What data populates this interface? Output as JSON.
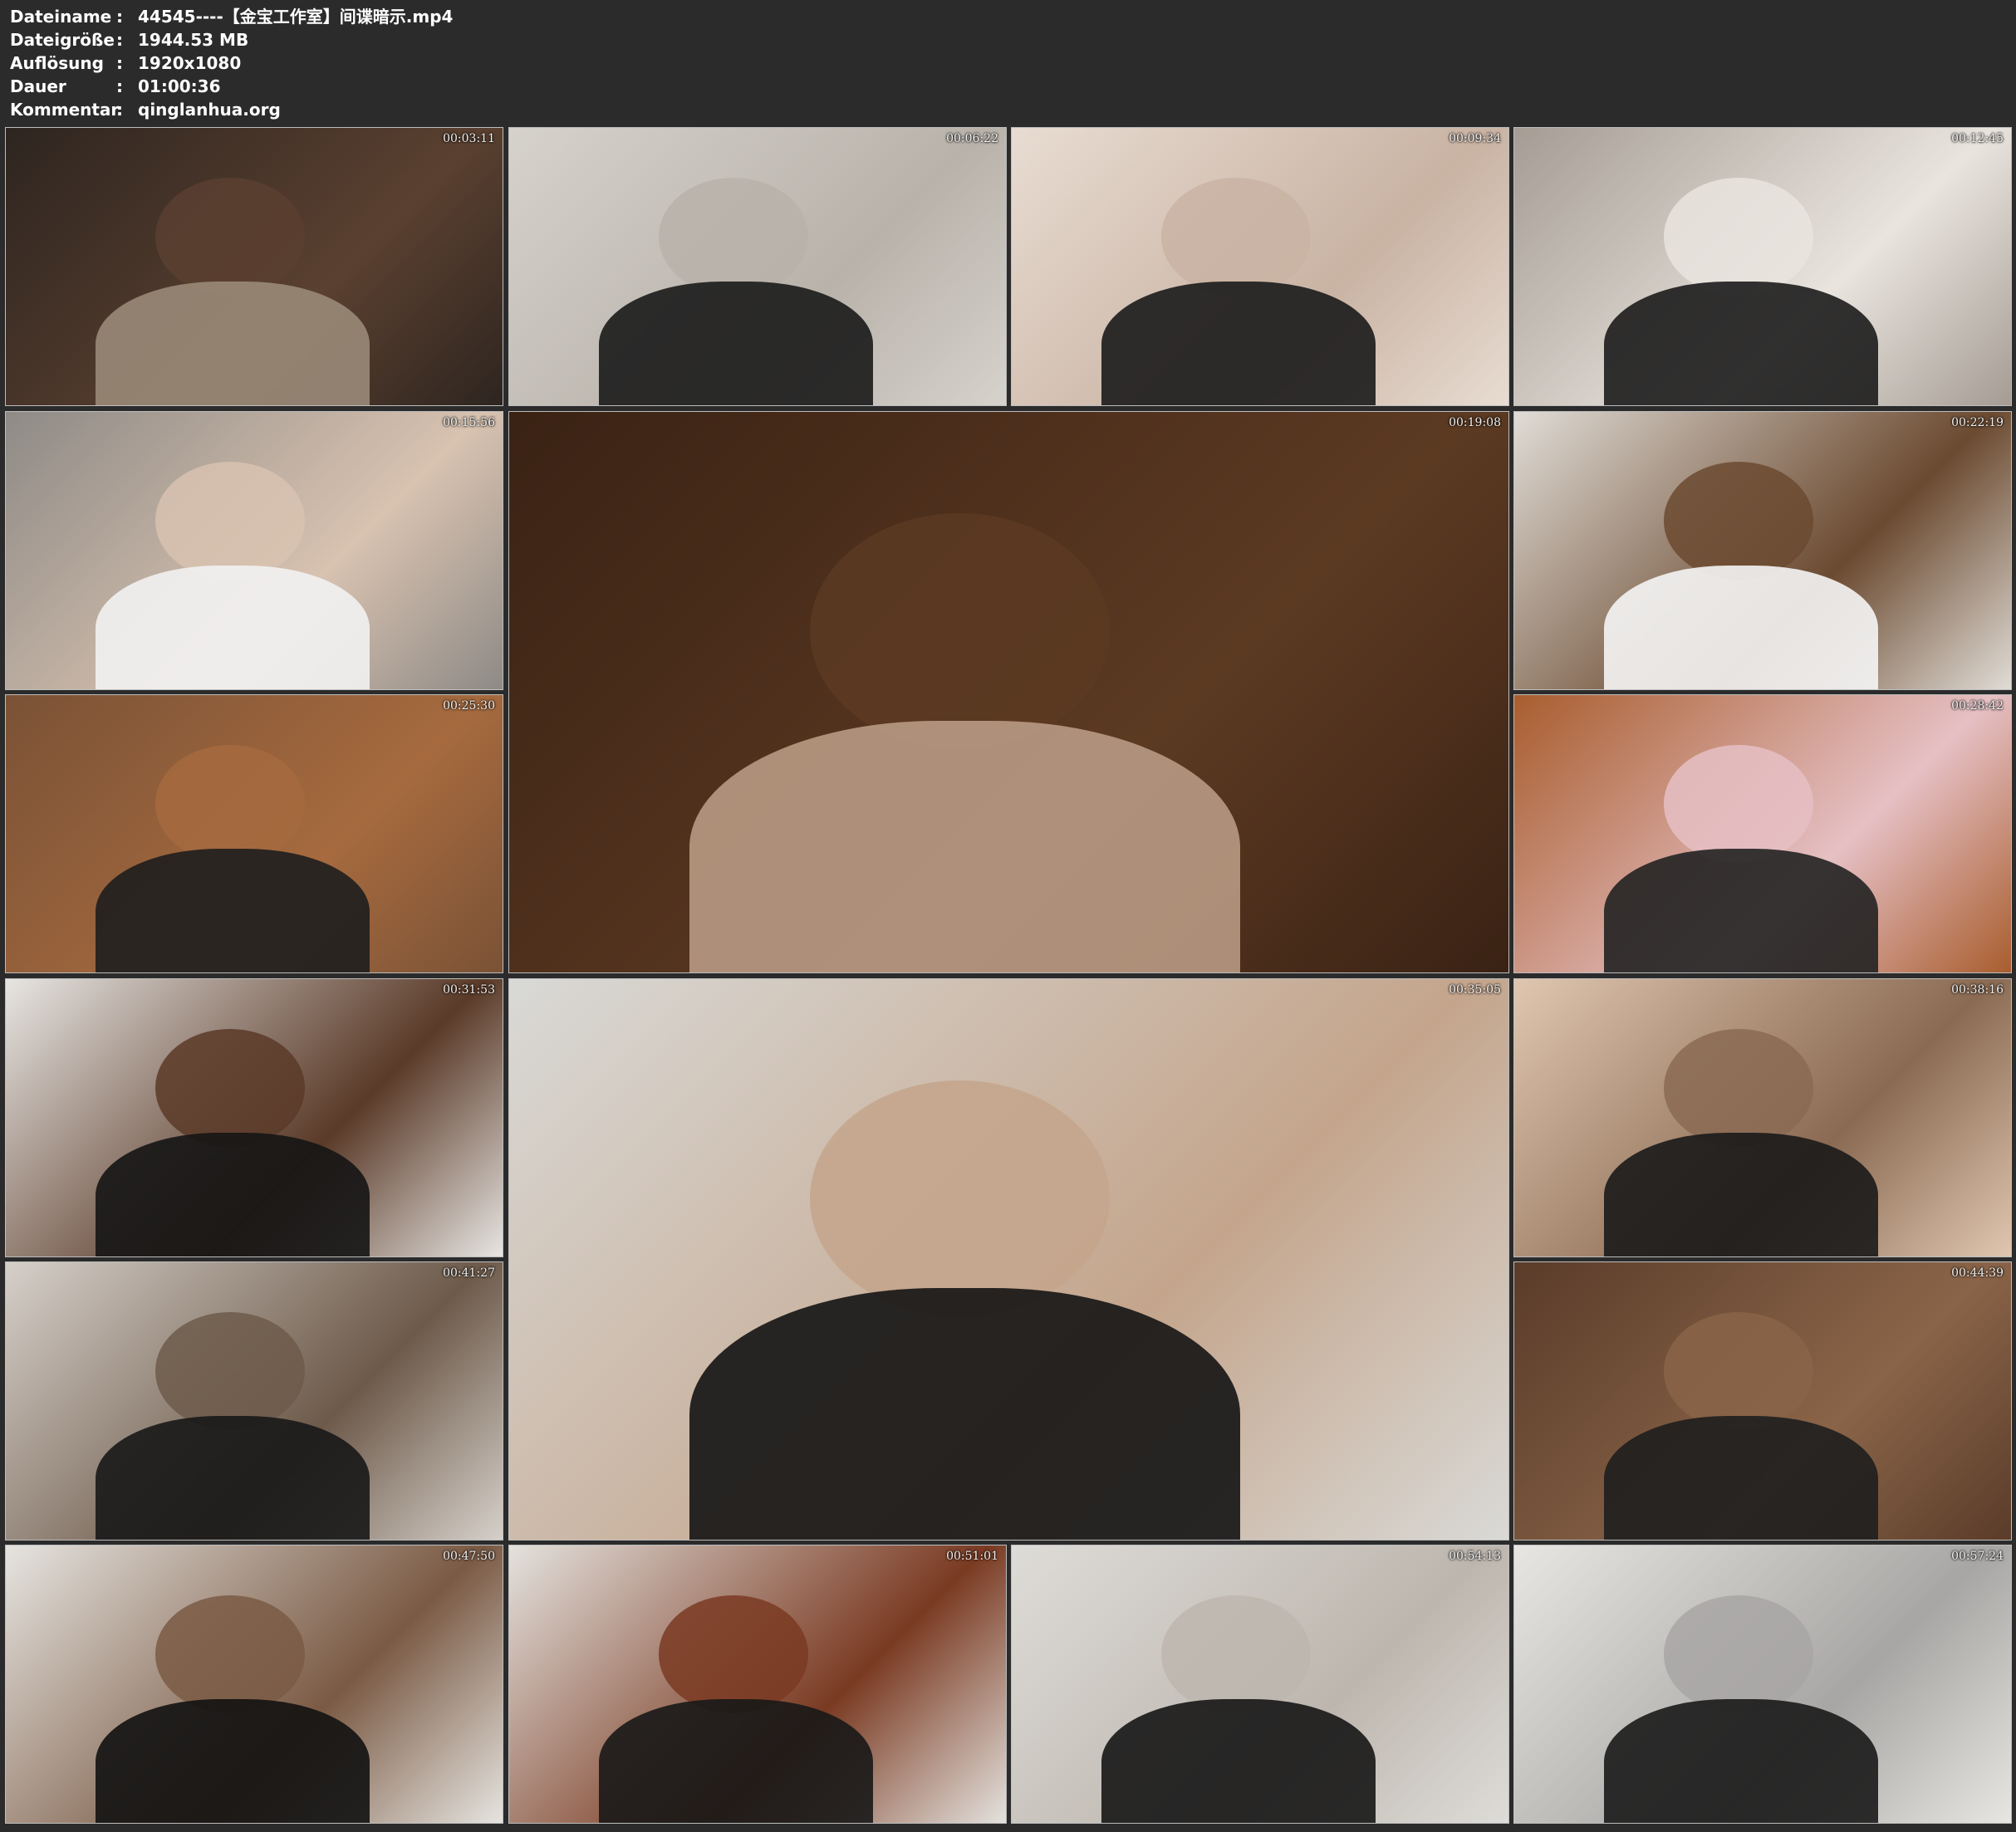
{
  "header": {
    "rows": [
      {
        "label": "Dateiname",
        "sep": ":",
        "value": "44545----【金宝工作室】间谍暗示.mp4"
      },
      {
        "label": "Dateigröße",
        "sep": ":",
        "value": "1944.53 MB"
      },
      {
        "label": "Auflösung",
        "sep": ":",
        "value": "1920x1080"
      },
      {
        "label": "Dauer",
        "sep": ":",
        "value": "01:00:36"
      },
      {
        "label": "Kommentar",
        "sep": ":",
        "value": "qinglanhua.org"
      }
    ]
  },
  "thumbnails": [
    {
      "time": "00:03:11",
      "colors": [
        "#2e2520",
        "#5a4030",
        "#9a8a78"
      ]
    },
    {
      "time": "00:06:22",
      "colors": [
        "#d6d2cc",
        "#b8b2aa",
        "#1a1a1a"
      ]
    },
    {
      "time": "00:09:34",
      "colors": [
        "#e8dcd2",
        "#c9b3a3",
        "#1b1b1b"
      ]
    },
    {
      "time": "00:12:45",
      "colors": [
        "#a59c94",
        "#e9e4de",
        "#1c1c1c"
      ]
    },
    {
      "time": "00:15:56",
      "colors": [
        "#8e8a86",
        "#d8c2b0",
        "#f2f2f2"
      ]
    },
    {
      "time": "00:19:08",
      "colors": [
        "#3a2214",
        "#5c3a22",
        "#b89a84"
      ]
    },
    {
      "time": "00:22:19",
      "colors": [
        "#e0dcd6",
        "#6b4a30",
        "#f5f5f5"
      ]
    },
    {
      "time": "00:25:30",
      "colors": [
        "#7a5236",
        "#a66a3e",
        "#1e1e1e"
      ]
    },
    {
      "time": "00:28:42",
      "colors": [
        "#a85d2e",
        "#e6c0c4",
        "#222222"
      ]
    },
    {
      "time": "00:31:53",
      "colors": [
        "#e7e5e2",
        "#5a3a28",
        "#151515"
      ]
    },
    {
      "time": "00:35:05",
      "colors": [
        "#d9d9d6",
        "#c4a58c",
        "#141414"
      ]
    },
    {
      "time": "00:38:16",
      "colors": [
        "#e0c6b0",
        "#8a6a52",
        "#1a1a1a"
      ]
    },
    {
      "time": "00:41:27",
      "colors": [
        "#d6d0ca",
        "#6d5a4a",
        "#181818"
      ]
    },
    {
      "time": "00:44:39",
      "colors": [
        "#5a3c2a",
        "#8a6448",
        "#1e1e1e"
      ]
    },
    {
      "time": "00:47:50",
      "colors": [
        "#e6e4e0",
        "#7a5a44",
        "#121212"
      ]
    },
    {
      "time": "00:51:01",
      "colors": [
        "#e4e2de",
        "#7a3a22",
        "#181818"
      ]
    },
    {
      "time": "00:54:13",
      "colors": [
        "#dedcd8",
        "#bdb6ae",
        "#161616"
      ]
    },
    {
      "time": "00:57:24",
      "colors": [
        "#e8e6e2",
        "#a8a6a4",
        "#1a1a1a"
      ]
    }
  ]
}
